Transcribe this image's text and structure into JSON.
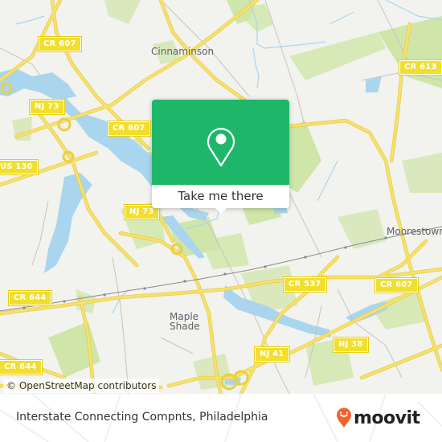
{
  "map": {
    "colors": {
      "background": "#f2f2ee",
      "park": "#cfe6a8",
      "water": "#a9d6ee",
      "road": "#f7e16f",
      "road_outline": "#e9cf45",
      "minor_road": "#c8c4c0",
      "rail": "#8a8a8a"
    },
    "places": [
      {
        "name": "Cinnaminson"
      },
      {
        "name": "Moorestown"
      },
      {
        "name": "Maple Shade"
      }
    ],
    "road_shields": [
      {
        "label": "CR 607"
      },
      {
        "label": "CR 613"
      },
      {
        "label": "NJ 73"
      },
      {
        "label": "CR 607"
      },
      {
        "label": "US 130"
      },
      {
        "label": "NJ 73"
      },
      {
        "label": "CR 537"
      },
      {
        "label": "CR 607"
      },
      {
        "label": "CR 644"
      },
      {
        "label": "NJ 41"
      },
      {
        "label": "NJ 38"
      },
      {
        "label": "CR 644"
      }
    ],
    "attribution": "© OpenStreetMap contributors"
  },
  "popup": {
    "icon": "map-pin-icon",
    "accent_color": "#1eb76a",
    "button_label": "Take me there"
  },
  "footer": {
    "title": "Interstate Connecting Compnts, Philadelphia",
    "brand": "moovit",
    "brand_color": "#f0642e"
  }
}
